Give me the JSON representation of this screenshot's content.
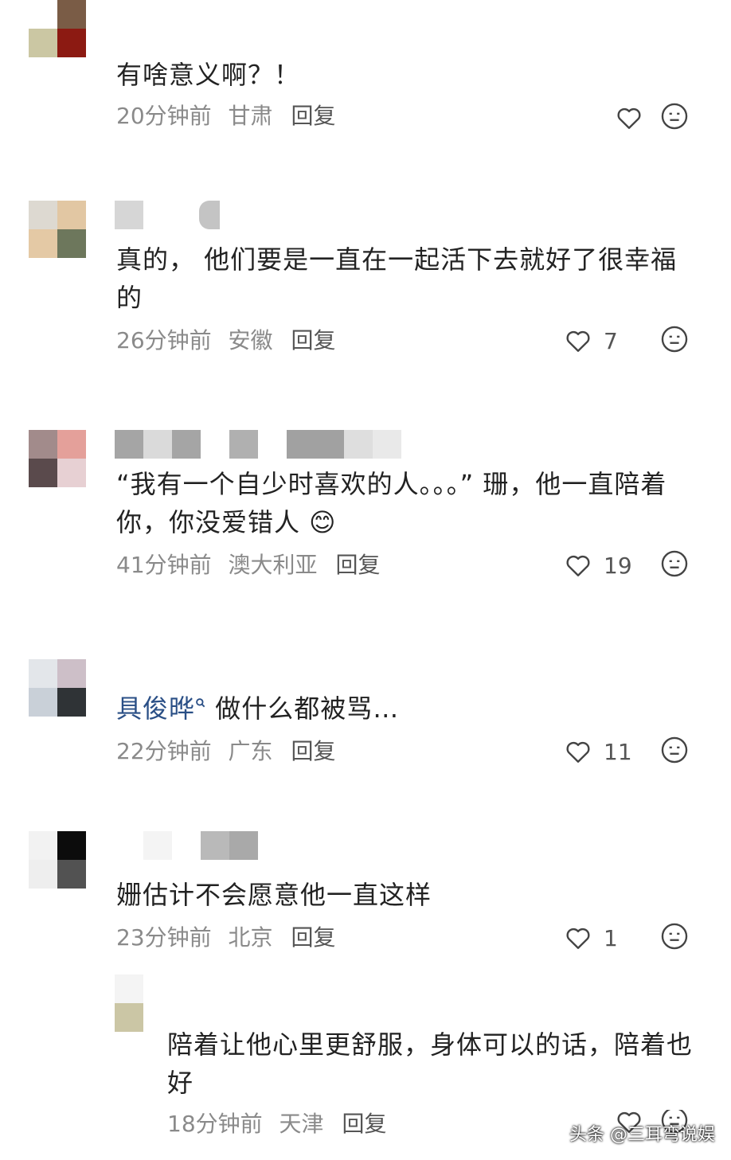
{
  "comments": [
    {
      "text": "有啥意义啊？！",
      "time": "20分钟前",
      "location": "甘肃",
      "reply_label": "回复",
      "likes": ""
    },
    {
      "text": "真的， 他们要是一直在一起活下去就好了很幸福的",
      "time": "26分钟前",
      "location": "安徽",
      "reply_label": "回复",
      "likes": "7"
    },
    {
      "text": "“我有一个自少时喜欢的人。。。” 珊，他一直陪着你，你没爱错人 😊",
      "time": "41分钟前",
      "location": "澳大利亚",
      "reply_label": "回复",
      "likes": "19"
    },
    {
      "mention": "具俊晔",
      "text": "做什么都被骂…",
      "time": "22分钟前",
      "location": "广东",
      "reply_label": "回复",
      "likes": "11"
    },
    {
      "text": "姗估计不会愿意他一直这样",
      "time": "23分钟前",
      "location": "北京",
      "reply_label": "回复",
      "likes": "1"
    }
  ],
  "reply": {
    "text": "陪着让他心里更舒服，身体可以的话，陪着也好",
    "time": "18分钟前",
    "location": "天津",
    "reply_label": "回复"
  },
  "watermark": "头条 @三耳弯说娱",
  "icons": {
    "like": "heart-outline-icon",
    "dislike": "meh-face-icon",
    "mention": "search-tag-icon"
  },
  "colors": {
    "text": "#222222",
    "meta": "#8a8a8a",
    "mention": "#2a4f86",
    "icon": "#444444"
  }
}
